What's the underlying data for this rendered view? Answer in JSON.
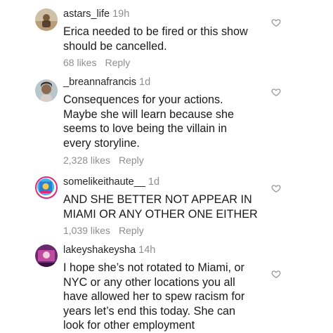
{
  "comments": [
    {
      "username": "astars_life",
      "time": "19h",
      "text": [
        "Erica needed to be fired or this show",
        "should be cancelled."
      ],
      "likes": "68 likes",
      "reply": "Reply",
      "avatar_icon": "profile-photo-icon"
    },
    {
      "username": "_breannafrancis",
      "time": "1d",
      "text": [
        "Consequences for your actions.",
        "Maybe she will learn because she",
        "seems to love being the villain in",
        "every storyline."
      ],
      "likes": "2,328 likes",
      "reply": "Reply",
      "avatar_icon": "profile-photo-icon"
    },
    {
      "username": "somelikeithaute__",
      "time": "1d",
      "text": [
        "AND SHE BETTER NOT APPEAR IN",
        "MIAMI OR ANY OTHER ONE EITHER"
      ],
      "likes": "1,039 likes",
      "reply": "Reply",
      "avatar_icon": "story-ring-profile-icon"
    },
    {
      "username": "lakeyshakeysha",
      "time": "14h",
      "text": [
        "I hope she’s not rotated to Miami, or",
        "NYC or any other locations you all",
        "have allowed her to spew racism for",
        "years let’s end this today. She can",
        "look for other employment"
      ],
      "likes": "",
      "reply": "",
      "avatar_icon": "profile-photo-icon"
    }
  ],
  "colors": {
    "text": "#1a1a1a",
    "meta": "#8e8e8e",
    "story_ring": "#e0287a"
  },
  "icons": {
    "like": "heart-outline-icon"
  }
}
